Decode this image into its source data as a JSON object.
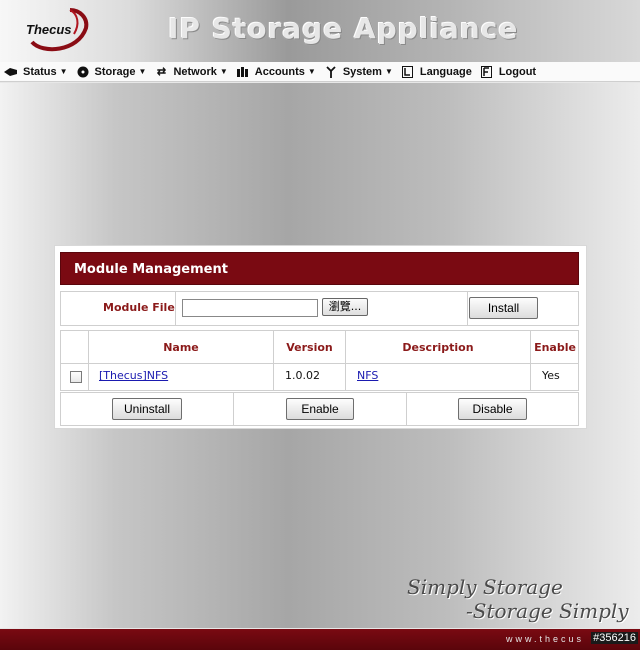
{
  "header": {
    "logo_text": "Thecus",
    "title": "IP Storage Appliance"
  },
  "menu": [
    {
      "label": "Status",
      "icon": "status-icon",
      "has_dropdown": true
    },
    {
      "label": "Storage",
      "icon": "storage-icon",
      "has_dropdown": true
    },
    {
      "label": "Network",
      "icon": "network-icon",
      "has_dropdown": true
    },
    {
      "label": "Accounts",
      "icon": "accounts-icon",
      "has_dropdown": true
    },
    {
      "label": "System",
      "icon": "system-icon",
      "has_dropdown": true
    },
    {
      "label": "Language",
      "icon": "language-icon",
      "has_dropdown": false
    },
    {
      "label": "Logout",
      "icon": "logout-icon",
      "has_dropdown": false
    }
  ],
  "panel": {
    "title": "Module Management",
    "module_file_label": "Module File",
    "module_file_value": "",
    "browse_label": "瀏覽...",
    "install_label": "Install",
    "columns": [
      "Name",
      "Version",
      "Description",
      "Enable"
    ],
    "rows": [
      {
        "checked": false,
        "name": "[Thecus]NFS",
        "version": "1.0.02",
        "description": "NFS",
        "enable": "Yes"
      }
    ],
    "uninstall_label": "Uninstall",
    "enable_label": "Enable",
    "disable_label": "Disable"
  },
  "slogan": {
    "line1": "Simply Storage",
    "line2": "-Storage Simply"
  },
  "footer": {
    "url": "www.thecus",
    "id": "#356216"
  },
  "colors": {
    "accent": "#7a0a12",
    "label": "#8b1a1a",
    "link": "#1a1ab0"
  }
}
